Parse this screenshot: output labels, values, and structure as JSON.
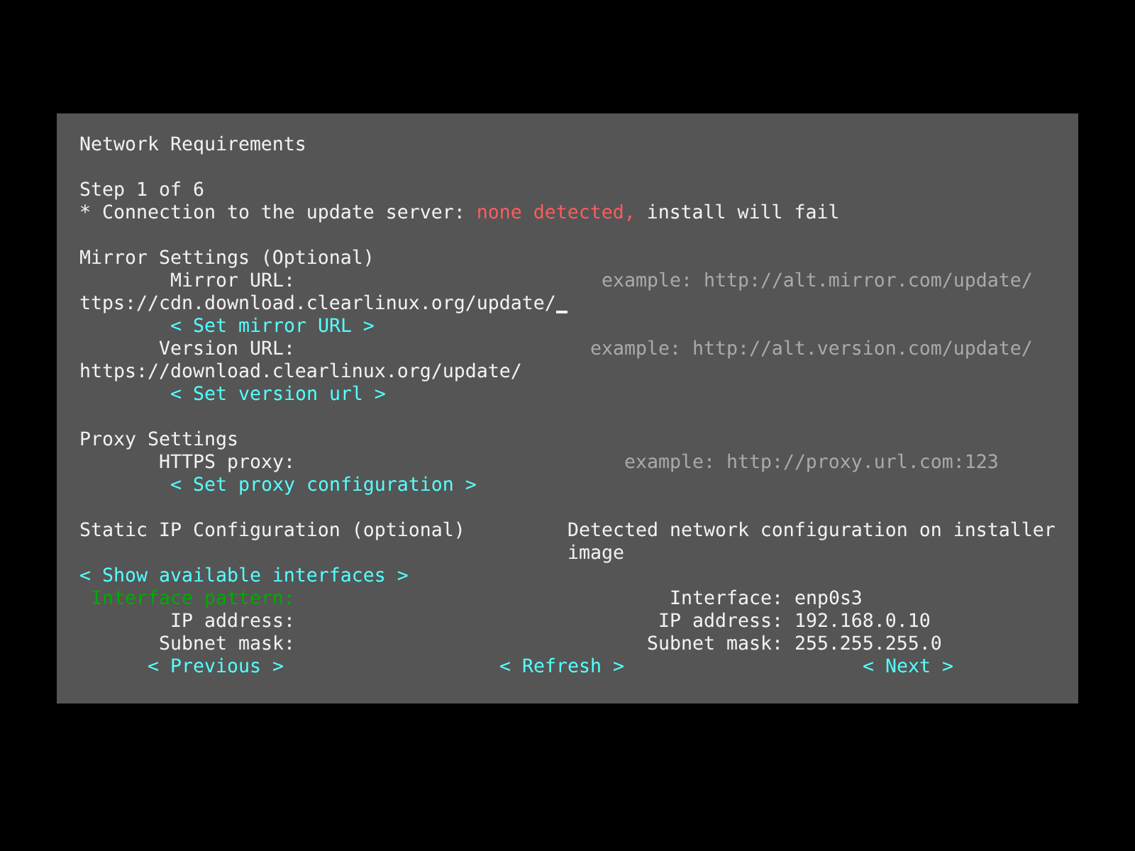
{
  "title": "Network Requirements",
  "step": "Step 1 of 6",
  "connection": {
    "bullet": "*",
    "label": "Connection to the update server:",
    "status": "none detected,",
    "status_ok": false,
    "result": "install will fail"
  },
  "mirror_settings": {
    "heading": "Mirror Settings (Optional)",
    "mirror_url": {
      "label": "Mirror URL:",
      "example": "example: http://alt.mirror.com/update/",
      "value": "ttps://cdn.download.clearlinux.org/update/",
      "focused": true
    },
    "set_mirror_button": "< Set mirror URL >",
    "version_url": {
      "label": "Version URL:",
      "example": "example: http://alt.version.com/update/",
      "value": "https://download.clearlinux.org/update/",
      "focused": false
    },
    "set_version_button": "< Set version url >"
  },
  "proxy_settings": {
    "heading": "Proxy Settings",
    "https_proxy": {
      "label": "HTTPS proxy:",
      "example": "example: http://proxy.url.com:123"
    },
    "set_proxy_button": "< Set proxy configuration >"
  },
  "static_ip": {
    "heading": "Static IP Configuration (optional)",
    "show_interfaces_button": "< Show available interfaces >",
    "fields": [
      {
        "label": "Interface pattern:",
        "focused": true
      },
      {
        "label": "IP address:",
        "focused": false
      },
      {
        "label": "Subnet mask:",
        "focused": false
      }
    ]
  },
  "detected": {
    "heading": "Detected network configuration on installer image",
    "rows": [
      {
        "label": "Interface:",
        "value": "enp0s3"
      },
      {
        "label": "IP address:",
        "value": "192.168.0.10"
      },
      {
        "label": "Subnet mask:",
        "value": "255.255.255.0"
      }
    ]
  },
  "buttons": [
    {
      "label": "< Previous >"
    },
    {
      "label": "< Refresh >"
    },
    {
      "label": "< Next >"
    }
  ]
}
